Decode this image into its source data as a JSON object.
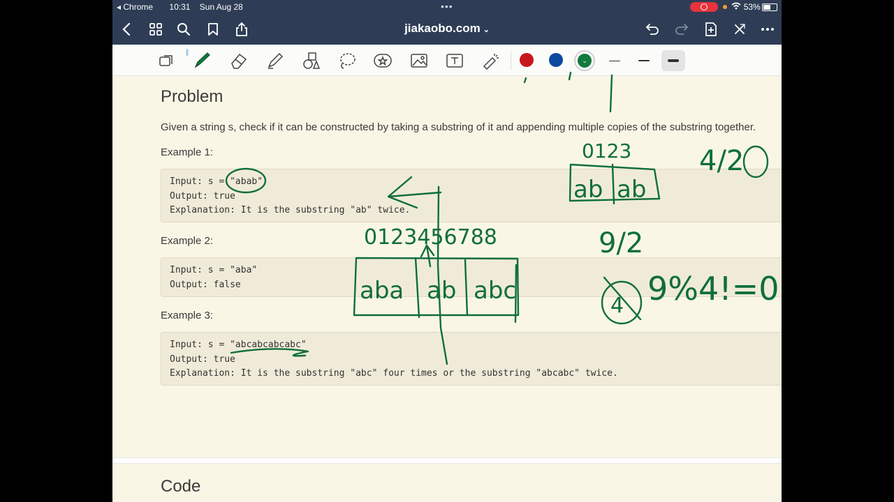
{
  "status": {
    "back_app": "Chrome",
    "time": "10:31",
    "date": "Sun Aug 28",
    "battery": "53%",
    "battery_level": 0.53
  },
  "nav": {
    "domain": "jiakaobo.com"
  },
  "toolbar": {
    "colors": [
      "#c8161d",
      "#0b4a9c",
      "#127a3f"
    ],
    "selected_color": "#127a3f"
  },
  "content": {
    "problem_title": "Problem",
    "problem_text": "Given a string s, check if it can be constructed by taking a substring of it and appending multiple copies of the substring together.",
    "examples": [
      {
        "label": "Example 1:",
        "lines": [
          "Input: s = \"abab\"",
          "Output: true",
          "Explanation: It is the substring \"ab\" twice."
        ]
      },
      {
        "label": "Example 2:",
        "lines": [
          "Input: s = \"aba\"",
          "Output: false"
        ]
      },
      {
        "label": "Example 3:",
        "lines": [
          "Input: s = \"abcabcabcabc\"",
          "Output: true",
          "Explanation: It is the substring \"abc\" four times or the substring \"abcabc\" twice."
        ]
      }
    ],
    "code_title": "Code"
  },
  "ink": {
    "indices_left": "0123456788",
    "indices_right": "0123",
    "boxes_left": [
      "aba",
      "ab",
      "abc"
    ],
    "boxes_right": [
      "ab",
      "ab"
    ],
    "fraction_top": "4/2",
    "fraction_mid": "9/2",
    "expr": "9%4!=0",
    "circled": "4"
  }
}
